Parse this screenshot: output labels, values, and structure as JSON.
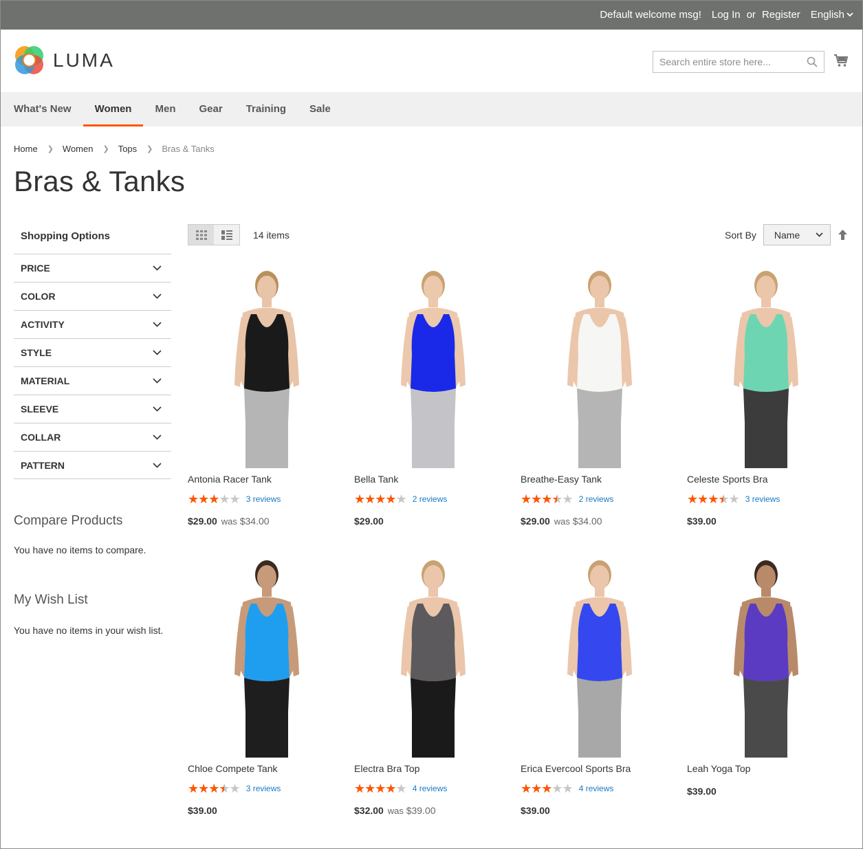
{
  "topbar": {
    "welcome": "Default welcome msg!",
    "login": "Log In",
    "or": "or",
    "register": "Register",
    "language": "English"
  },
  "header": {
    "logo_text": "LUMA",
    "search_placeholder": "Search entire store here..."
  },
  "nav": [
    "What's New",
    "Women",
    "Men",
    "Gear",
    "Training",
    "Sale"
  ],
  "breadcrumb": [
    "Home",
    "Women",
    "Tops",
    "Bras & Tanks"
  ],
  "page_title": "Bras & Tanks",
  "sidebar": {
    "title": "Shopping Options",
    "filters": [
      "PRICE",
      "COLOR",
      "ACTIVITY",
      "STYLE",
      "MATERIAL",
      "SLEEVE",
      "COLLAR",
      "PATTERN"
    ],
    "compare_title": "Compare Products",
    "compare_text": "You have no items to compare.",
    "wishlist_title": "My Wish List",
    "wishlist_text": "You have no items in your wish list."
  },
  "toolbar": {
    "count": "14 items",
    "sort_label": "Sort By",
    "sort_value": "Name"
  },
  "products": [
    {
      "name": "Antonia Racer Tank",
      "rating": 0.6,
      "reviews": "3 reviews",
      "price": "$29.00",
      "was_label": "was",
      "was": "$34.00",
      "top": "#1a1a1a",
      "accent": "#8a8a8a",
      "bottom": "#b5b5b5",
      "skin": "#e8c4a8",
      "hair": "#b8905c"
    },
    {
      "name": "Bella Tank",
      "rating": 0.8,
      "reviews": "2 reviews",
      "price": "$29.00",
      "was_label": "",
      "was": "",
      "top": "#1a29e8",
      "accent": "#1a29e8",
      "bottom": "#c4c4c8",
      "skin": "#ecc8ac",
      "hair": "#c9a070"
    },
    {
      "name": "Breathe-Easy Tank",
      "rating": 0.7,
      "reviews": "2 reviews",
      "price": "$29.00",
      "was_label": "was",
      "was": "$34.00",
      "top": "#f6f6f4",
      "accent": "#f6f6f4",
      "bottom": "#b5b5b5",
      "skin": "#ebc6aa",
      "hair": "#c8a272"
    },
    {
      "name": "Celeste Sports Bra",
      "rating": 0.7,
      "reviews": "3 reviews",
      "price": "$39.00",
      "was_label": "",
      "was": "",
      "top": "#6ed5b2",
      "accent": "#6ed5b2",
      "bottom": "#3c3c3c",
      "skin": "#ebc6aa",
      "hair": "#c8a272"
    },
    {
      "name": "Chloe Compete Tank",
      "rating": 0.7,
      "reviews": "3 reviews",
      "price": "$39.00",
      "was_label": "",
      "was": "",
      "top": "#1f9ef0",
      "accent": "#1f9ef0",
      "bottom": "#1e1e1e",
      "skin": "#c79a7a",
      "hair": "#3a2a20"
    },
    {
      "name": "Electra Bra Top",
      "rating": 0.8,
      "reviews": "4 reviews",
      "price": "$32.00",
      "was_label": "was",
      "was": "$39.00",
      "top": "#5c5a5c",
      "accent": "#5c5a5c",
      "bottom": "#1a1a1a",
      "skin": "#ebc6aa",
      "hair": "#c8a272"
    },
    {
      "name": "Erica Evercool Sports Bra",
      "rating": 0.6,
      "reviews": "4 reviews",
      "price": "$39.00",
      "was_label": "",
      "was": "",
      "top": "#3548ef",
      "accent": "#3548ef",
      "bottom": "#a8a8a8",
      "skin": "#ebc6aa",
      "hair": "#c8a272"
    },
    {
      "name": "Leah Yoga Top",
      "rating": 0,
      "reviews": "",
      "price": "$39.00",
      "was_label": "",
      "was": "",
      "top": "#5a3bc2",
      "accent": "#5a3bc2",
      "bottom": "#4a4a4a",
      "skin": "#b98a6a",
      "hair": "#3a2a20"
    }
  ],
  "icons": {
    "cart": "cart-icon",
    "search": "search-icon",
    "grid_mode": "grid-icon",
    "list_mode": "list-icon",
    "sort_direction": "arrow-up-icon"
  },
  "colors": {
    "accent": "#ff5501",
    "link": "#1979c3",
    "topbar": "#6e716e"
  }
}
